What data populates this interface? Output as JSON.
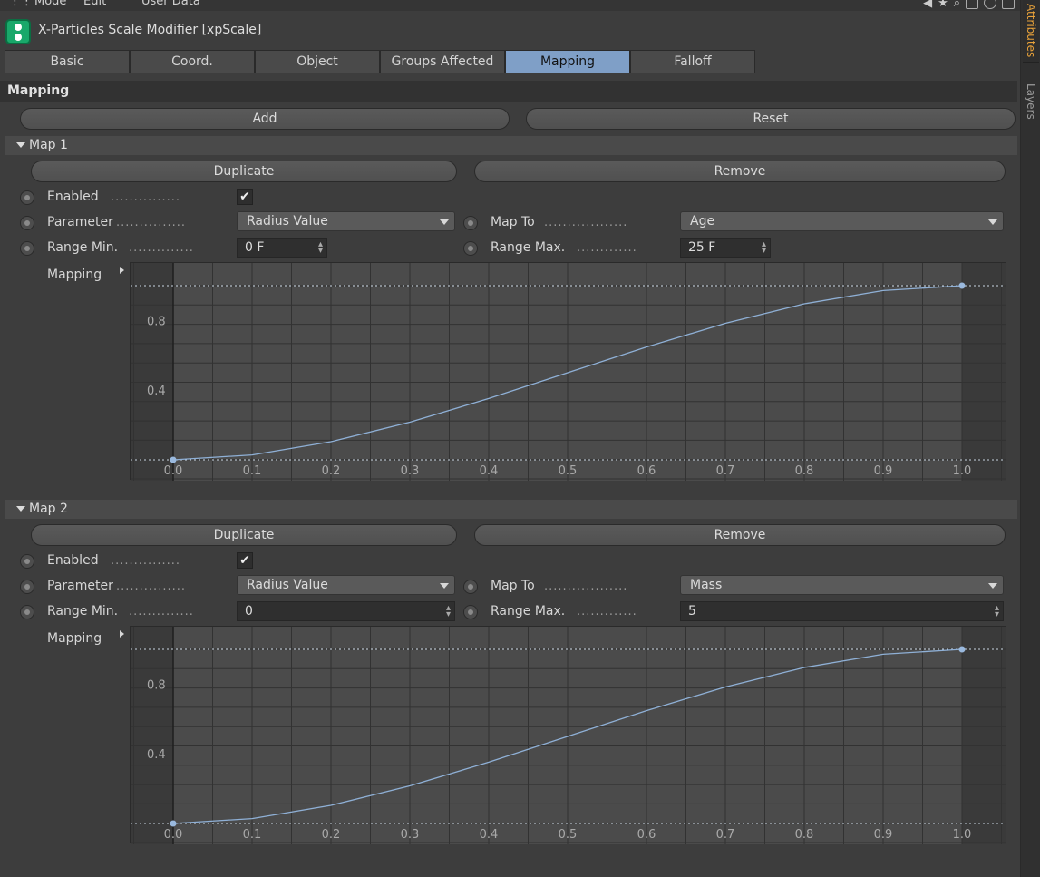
{
  "menu": {
    "items": [
      "Mode",
      "Edit",
      "User Data"
    ]
  },
  "side_tabs": [
    "Attributes",
    "Layers"
  ],
  "object": {
    "title": "X-Particles Scale Modifier [xpScale]"
  },
  "tabs": [
    "Basic",
    "Coord.",
    "Object",
    "Groups Affected",
    "Mapping",
    "Falloff"
  ],
  "active_tab": "Mapping",
  "section": {
    "title": "Mapping",
    "add_label": "Add",
    "reset_label": "Reset"
  },
  "maps": [
    {
      "title": "Map 1",
      "duplicate_label": "Duplicate",
      "remove_label": "Remove",
      "enabled_label": "Enabled",
      "enabled": true,
      "parameter_label": "Parameter",
      "parameter_value": "Radius Value",
      "map_to_label": "Map To",
      "map_to_value": "Age",
      "range_min_label": "Range Min.",
      "range_min_value": "0 F",
      "range_max_label": "Range Max.",
      "range_max_value": "25 F",
      "mapping_label": "Mapping"
    },
    {
      "title": "Map 2",
      "duplicate_label": "Duplicate",
      "remove_label": "Remove",
      "enabled_label": "Enabled",
      "enabled": true,
      "parameter_label": "Parameter",
      "parameter_value": "Radius Value",
      "map_to_label": "Map To",
      "map_to_value": "Mass",
      "range_min_label": "Range Min.",
      "range_min_value": "0",
      "range_max_label": "Range Max.",
      "range_max_value": "5",
      "mapping_label": "Mapping"
    }
  ],
  "chart_data": [
    {
      "type": "line",
      "x_ticks": [
        "0.0",
        "0.1",
        "0.2",
        "0.3",
        "0.4",
        "0.5",
        "0.6",
        "0.7",
        "0.8",
        "0.9",
        "1.0"
      ],
      "y_ticks": [
        "0.8",
        "0.4"
      ],
      "xlim": [
        0,
        1
      ],
      "ylim": [
        0,
        1
      ],
      "grid": true,
      "series": [
        {
          "x": [
            0,
            0.1,
            0.2,
            0.3,
            0.4,
            0.5,
            0.6,
            0.7,
            0.8,
            0.9,
            1.0
          ],
          "y": [
            0,
            0.028,
            0.104,
            0.216,
            0.352,
            0.5,
            0.648,
            0.784,
            0.896,
            0.972,
            1.0
          ],
          "color": "#8fb0d6"
        }
      ]
    },
    {
      "type": "line",
      "x_ticks": [
        "0.0",
        "0.1",
        "0.2",
        "0.3",
        "0.4",
        "0.5",
        "0.6",
        "0.7",
        "0.8",
        "0.9",
        "1.0"
      ],
      "y_ticks": [
        "0.8",
        "0.4"
      ],
      "xlim": [
        0,
        1
      ],
      "ylim": [
        0,
        1
      ],
      "grid": true,
      "series": [
        {
          "x": [
            0,
            0.1,
            0.2,
            0.3,
            0.4,
            0.5,
            0.6,
            0.7,
            0.8,
            0.9,
            1.0
          ],
          "y": [
            0,
            0.028,
            0.104,
            0.216,
            0.352,
            0.5,
            0.648,
            0.784,
            0.896,
            0.972,
            1.0
          ],
          "color": "#8fb0d6"
        }
      ]
    }
  ],
  "colors": {
    "background": "#3d3d3d",
    "active_tab": "#7f9fc7",
    "accent_orange": "#e8a23a",
    "object_icon": "#19a86a",
    "curve": "#8fb0d6"
  }
}
